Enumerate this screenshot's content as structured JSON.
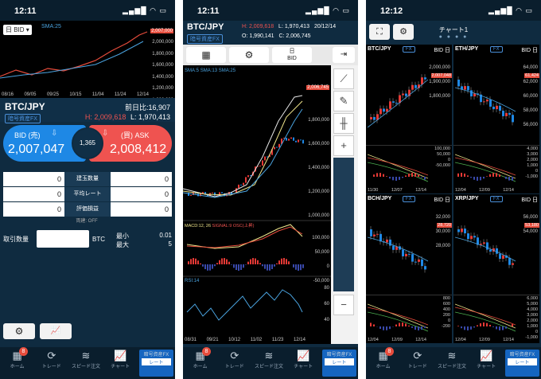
{
  "screen1": {
    "time": "12:11",
    "status_icons": "▂▄▆█ ◠ ▭",
    "period_select": "日 BID",
    "sma_label": "SMA:25",
    "price_tag": "2,007,000",
    "y_ticks": [
      "2,000,000",
      "1,800,000",
      "1,600,000",
      "1,400,000",
      "1,200,000",
      "1,000,000"
    ],
    "x_ticks": [
      "08/16",
      "09/05",
      "09/25",
      "10/15",
      "11/04",
      "11/24",
      "12/14"
    ],
    "pair": "BTC/JPY",
    "prev_change_label": "前日比:",
    "prev_change_value": "16,907",
    "account_type": "暗号資産FX",
    "high": "H: 2,009,618",
    "low": "L: 1,970,413",
    "bid_label": "BID (売)",
    "bid_price": "2,007,047",
    "spread": "1,365",
    "ask_label": "(買) ASK",
    "ask_price": "2,008,412",
    "positions": [
      {
        "label": "建玉数量",
        "left": "0",
        "right": "0"
      },
      {
        "label": "平均レート",
        "left": "0",
        "right": "0"
      },
      {
        "label": "評価損益",
        "left": "0",
        "right": "0"
      }
    ],
    "both_label": "両建: OFF",
    "qty_label": "取引数量",
    "unit": "BTC",
    "min_label": "最小",
    "min_value": "0.01",
    "max_label": "最大",
    "max_value": "5"
  },
  "screen2": {
    "time": "12:11",
    "status_icons": "▂▄▆█ ◠ ▭",
    "pair": "BTC/JPY",
    "account_type": "暗号資産FX",
    "high": "H: 2,009,618",
    "low": "L: 1,970,413",
    "date": "20/12/14",
    "open": "O: 1,990,141",
    "close": "C: 2,006,745",
    "toolbar_bid_line1": "日",
    "toolbar_bid_line2": "BID",
    "sma_legend": [
      "SMA:5",
      "SMA:13",
      "SMA:25"
    ],
    "price_tag": "2,006,745",
    "y_ticks": [
      "1,800,000",
      "1,600,000",
      "1,400,000",
      "1,200,000",
      "1,000,000"
    ],
    "macd_legend": [
      "MACD:12, 26",
      "SIGNAL:9",
      "OSC(上昇)"
    ],
    "macd_ticks": [
      "100,000",
      "50,000",
      "0",
      "-50,000"
    ],
    "rsi_label": "RSI:14",
    "rsi_ticks": [
      "80",
      "60",
      "40"
    ],
    "x_ticks": [
      "08/31",
      "09/21",
      "10/12",
      "11/02",
      "11/23",
      "12/14"
    ]
  },
  "screen3": {
    "time": "12:12",
    "status_icons": "▂▄▆█ ◠ ▭",
    "title": "チャート1",
    "charts": [
      {
        "pair": "BTC/JPY",
        "tag": "FX",
        "side": "BID 日",
        "price": "2,007,048",
        "ticks": [
          "2,000,000",
          "1,900,000",
          "1,800,000"
        ],
        "macd": [
          "100,000",
          "50,000",
          "0",
          "-50,000"
        ],
        "x": [
          "11/30",
          "12/07",
          "12/14"
        ],
        "up": true
      },
      {
        "pair": "ETH/JPY",
        "tag": "FX",
        "side": "BID 日",
        "price": "61,424",
        "ticks": [
          "64,000",
          "62,000",
          "60,000",
          "58,000",
          "56,000"
        ],
        "macd": [
          "4,000",
          "3,000",
          "2,000",
          "1,000",
          "0",
          "-1,000"
        ],
        "x": [
          "12/04",
          "12/09",
          "12/14"
        ],
        "up": false
      },
      {
        "pair": "BCH/JPY",
        "tag": "FX",
        "side": "BID 日",
        "price": "28,720",
        "ticks": [
          "32,000",
          "30,000",
          "28,000"
        ],
        "macd": [
          "800",
          "600",
          "400",
          "200",
          "0",
          "-200"
        ],
        "x": [
          "12/04",
          "12/09",
          "12/14"
        ],
        "up": false
      },
      {
        "pair": "XRP/JPY",
        "tag": "FX",
        "side": "BID 日",
        "price": "53,180",
        "ticks": [
          "56,000",
          "54,000"
        ],
        "macd": [
          "6,000",
          "5,000",
          "4,000",
          "3,000",
          "2,000",
          "1,000",
          "0",
          "-1,000"
        ],
        "x": [
          "12/04",
          "12/09",
          "12/14"
        ],
        "up": false
      }
    ]
  },
  "tabs": [
    "ホーム",
    "トレード",
    "スピード注文",
    "チャート",
    "暗号資産FX",
    "レート"
  ],
  "home_badge": "8",
  "colors": {
    "bid": "#1e88e5",
    "ask": "#ef5350",
    "bg": "#0f2b40",
    "up": "#e53935",
    "down": "#1e88e5"
  }
}
